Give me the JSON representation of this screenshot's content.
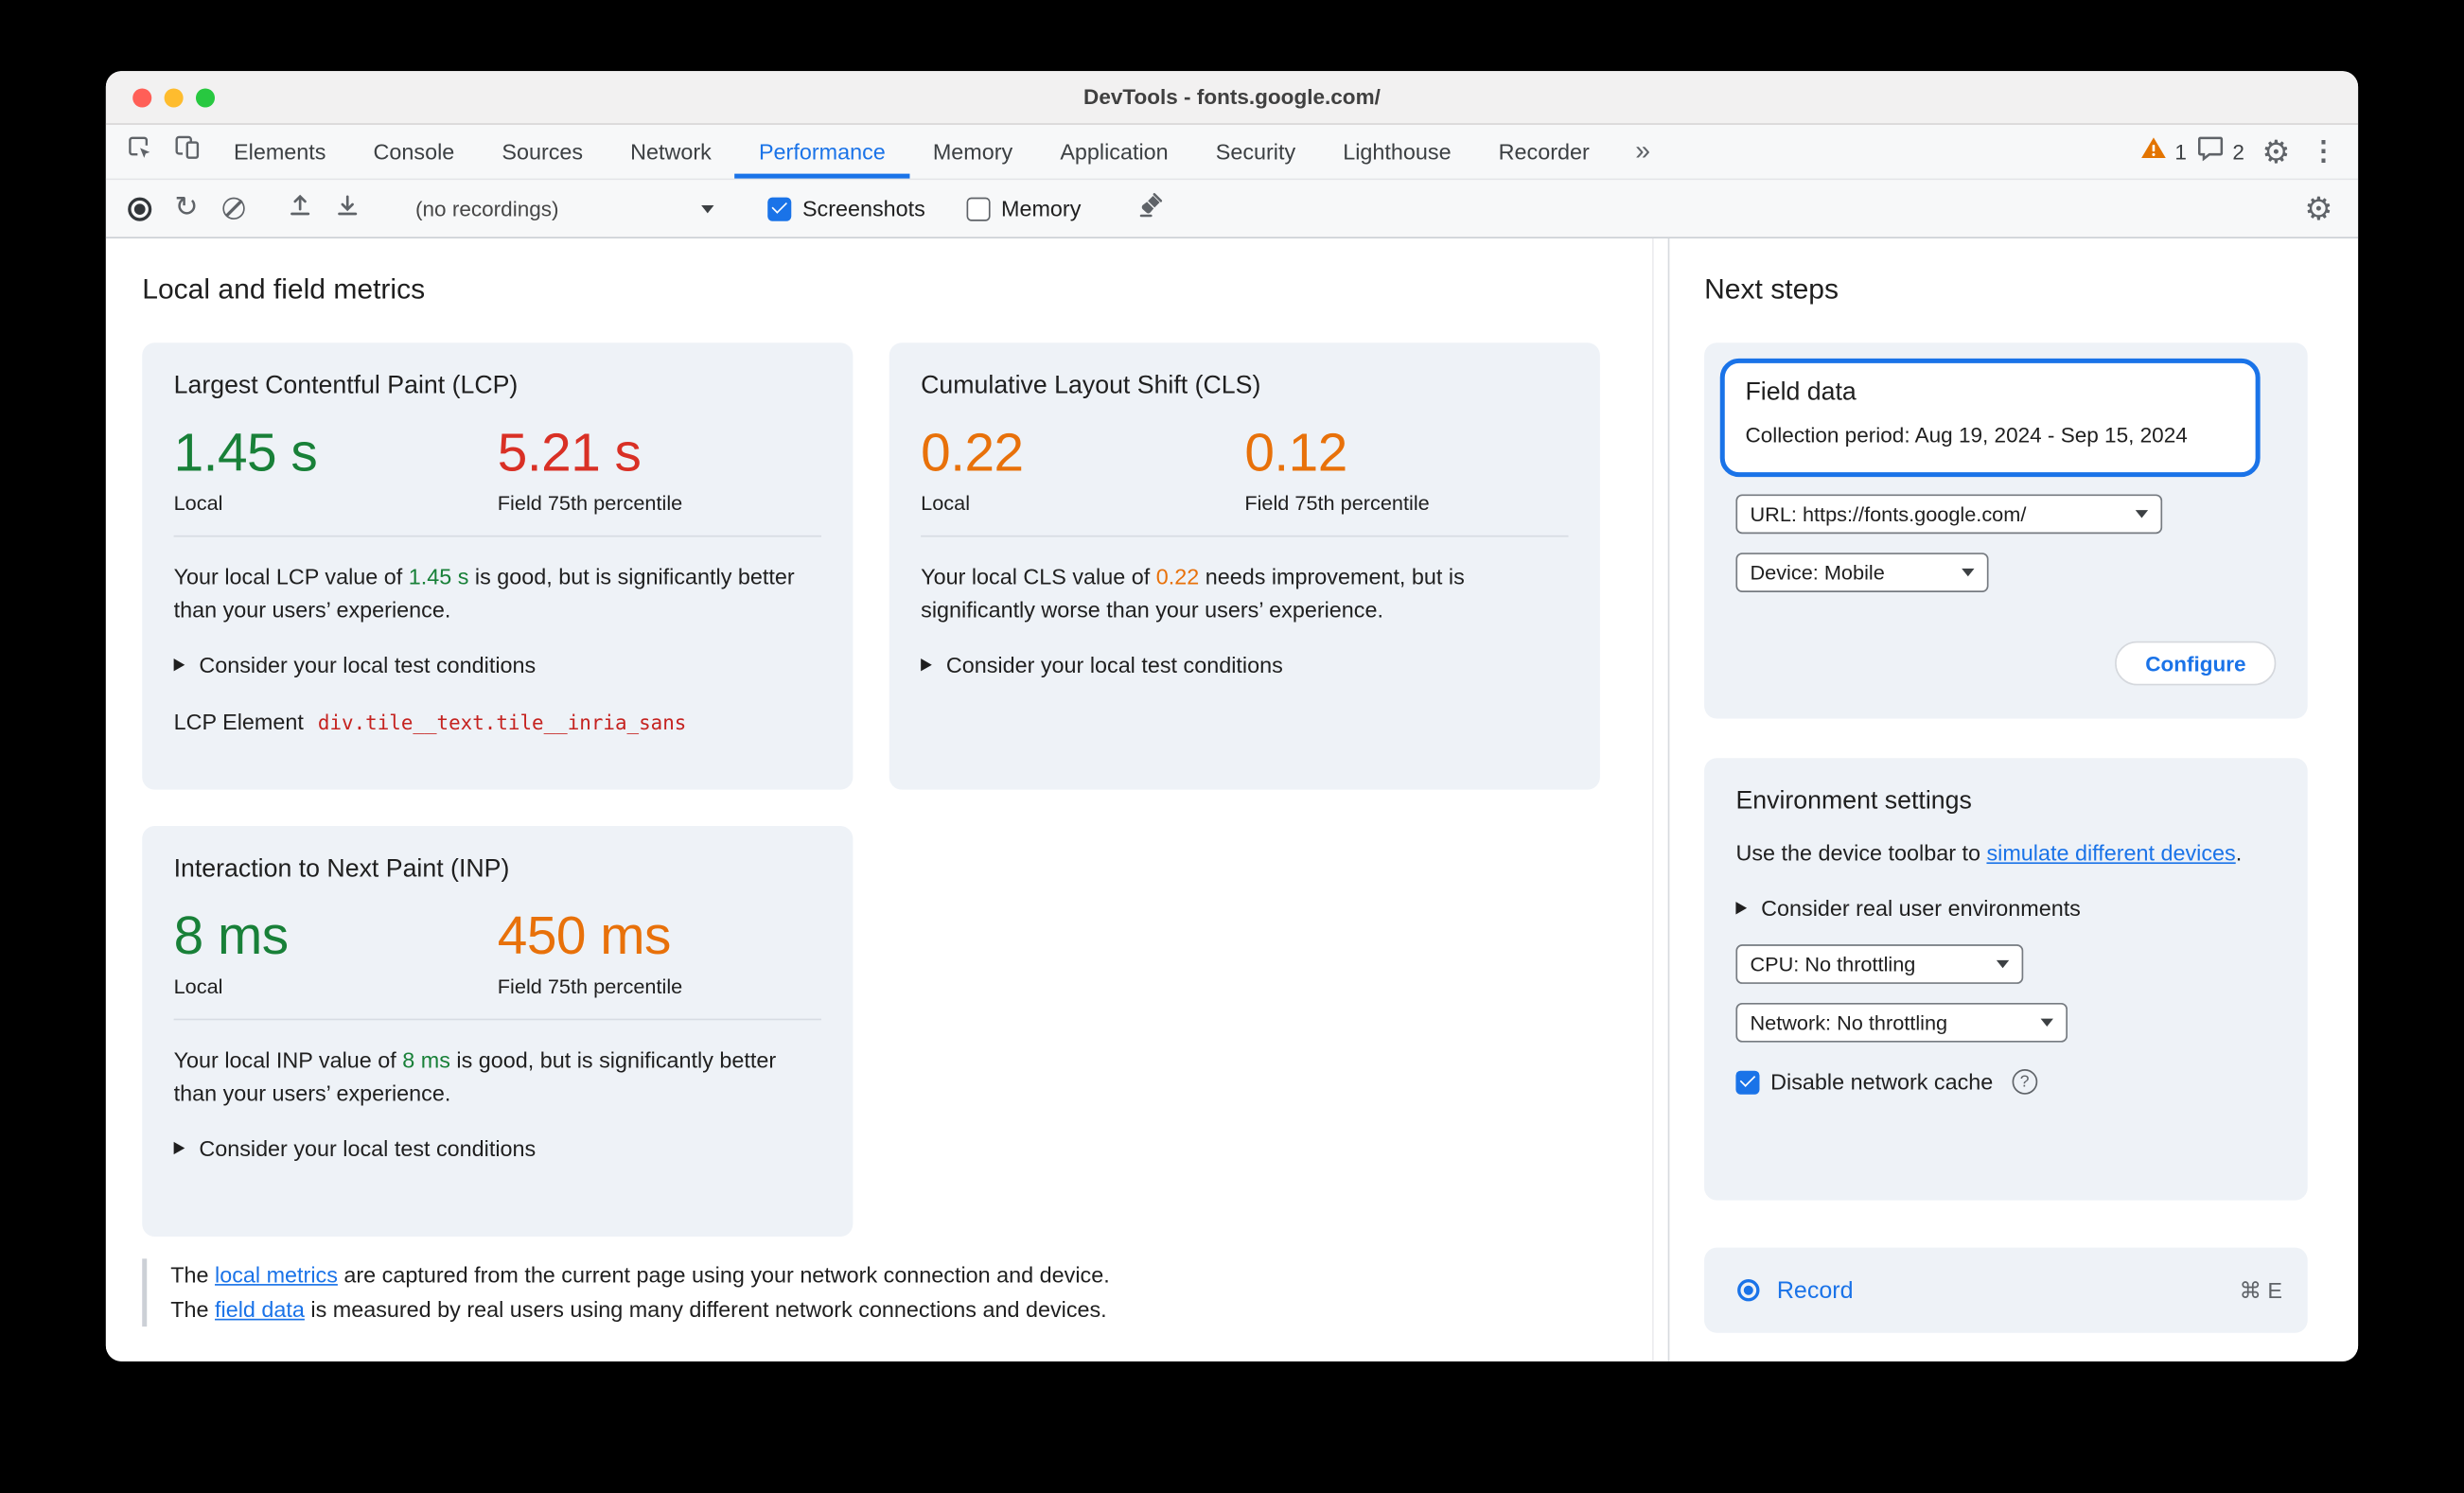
{
  "window": {
    "title": "DevTools - fonts.google.com/"
  },
  "tabs": {
    "items": [
      "Elements",
      "Console",
      "Sources",
      "Network",
      "Performance",
      "Memory",
      "Application",
      "Security",
      "Lighthouse",
      "Recorder"
    ],
    "more": "»",
    "warning_count": "1",
    "issues_count": "2"
  },
  "toolbar": {
    "recordings": "(no recordings)",
    "screenshots": "Screenshots",
    "memory": "Memory"
  },
  "main": {
    "heading": "Local and field metrics",
    "lcp": {
      "title": "Largest Contentful Paint (LCP)",
      "local_value": "1.45 s",
      "local_label": "Local",
      "field_value": "5.21 s",
      "field_label": "Field 75th percentile",
      "para_prefix": "Your local LCP value of ",
      "para_value": "1.45 s",
      "para_suffix": " is good, but is significantly better than your users’ experience.",
      "disclosure": "Consider your local test conditions",
      "element_label": "LCP Element",
      "element_value": "div.tile__text.tile__inria_sans"
    },
    "cls": {
      "title": "Cumulative Layout Shift (CLS)",
      "local_value": "0.22",
      "local_label": "Local",
      "field_value": "0.12",
      "field_label": "Field 75th percentile",
      "para_prefix": "Your local CLS value of ",
      "para_value": "0.22",
      "para_suffix": " needs improvement, but is significantly worse than your users’ experience.",
      "disclosure": "Consider your local test conditions"
    },
    "inp": {
      "title": "Interaction to Next Paint (INP)",
      "local_value": "8 ms",
      "local_label": "Local",
      "field_value": "450 ms",
      "field_label": "Field 75th percentile",
      "para_prefix": "Your local INP value of ",
      "para_value": "8 ms",
      "para_suffix": " is good, but is significantly better than your users’ experience.",
      "disclosure": "Consider your local test conditions"
    },
    "footer": {
      "l1_pre": "The ",
      "l1_link": "local metrics",
      "l1_post": " are captured from the current page using your network connection and device.",
      "l2_pre": "The ",
      "l2_link": "field data",
      "l2_post": " is measured by real users using many different network connections and devices."
    }
  },
  "sidebar": {
    "heading": "Next steps",
    "field_data": {
      "title": "Field data",
      "period": "Collection period: Aug 19, 2024 - Sep 15, 2024",
      "url_select": "URL: https://fonts.google.com/",
      "device_select": "Device: Mobile",
      "configure": "Configure"
    },
    "env": {
      "title": "Environment settings",
      "para_prefix": "Use the device toolbar to ",
      "para_link": "simulate different devices",
      "para_suffix": ".",
      "disclosure": "Consider real user environments",
      "cpu_select": "CPU: No throttling",
      "network_select": "Network: No throttling",
      "cache_label": "Disable network cache",
      "help": "?"
    },
    "record": {
      "label": "Record",
      "shortcut": "⌘ E"
    }
  },
  "colors": {
    "accent": "#1a73e8",
    "good": "#188038",
    "needs_improvement": "#e8710a",
    "poor": "#d93025",
    "warning": "#e37400"
  }
}
